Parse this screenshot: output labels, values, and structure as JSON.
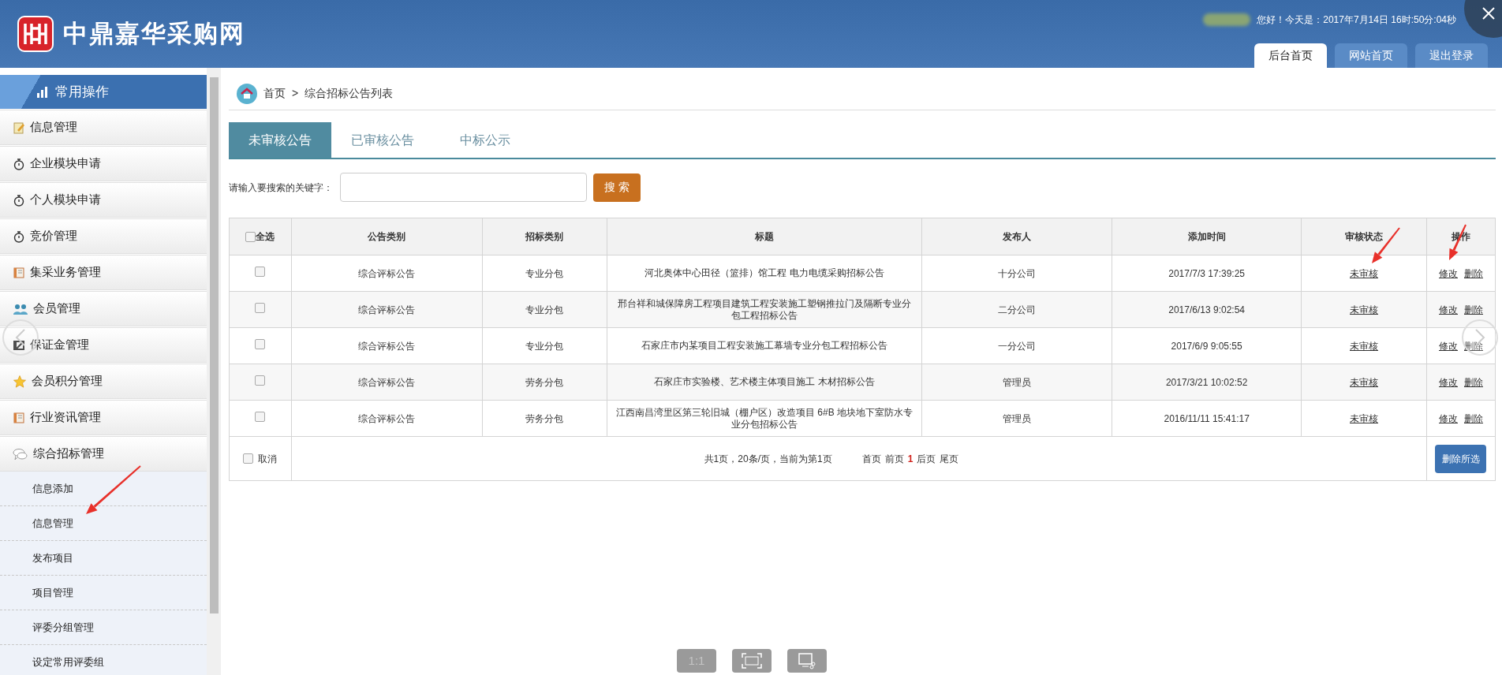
{
  "header": {
    "logo_text": "中鼎嘉华采购网",
    "greeting": "您好！今天是：2017年7月14日 16时:50分:04秒",
    "nav": [
      {
        "label": "后台首页",
        "selected": true
      },
      {
        "label": "网站首页",
        "selected": false
      },
      {
        "label": "退出登录",
        "selected": false
      }
    ]
  },
  "sidebar": {
    "title": "常用操作",
    "items": [
      {
        "label": "信息管理",
        "kind": "note"
      },
      {
        "label": "企业模块申请",
        "kind": "stopwatch"
      },
      {
        "label": "个人模块申请",
        "kind": "stopwatch"
      },
      {
        "label": "竞价管理",
        "kind": "stopwatch"
      },
      {
        "label": "集采业务管理",
        "kind": "book"
      },
      {
        "label": "会员管理",
        "kind": "people"
      },
      {
        "label": "保证金管理",
        "kind": "film"
      },
      {
        "label": "会员积分管理",
        "kind": "star"
      },
      {
        "label": "行业资讯管理",
        "kind": "book"
      },
      {
        "label": "综合招标管理",
        "kind": "chat",
        "children": [
          {
            "label": "信息添加"
          },
          {
            "label": "信息管理"
          },
          {
            "label": "发布项目"
          },
          {
            "label": "项目管理"
          },
          {
            "label": "评委分组管理"
          },
          {
            "label": "设定常用评委组"
          }
        ]
      }
    ]
  },
  "breadcrumb": {
    "home": "首页",
    "separator": ">",
    "current": "综合招标公告列表"
  },
  "tabs": [
    {
      "label": "未审核公告",
      "selected": true
    },
    {
      "label": "已审核公告",
      "selected": false
    },
    {
      "label": "中标公示",
      "selected": false
    }
  ],
  "search": {
    "label": "请输入要搜索的关键字：",
    "button": "搜 索"
  },
  "table": {
    "select_all": {
      "label": "全选",
      "checked": false
    },
    "columns": [
      "公告类别",
      "招标类别",
      "标题",
      "发布人",
      "添加时间",
      "审核状态",
      "操作"
    ],
    "rows": [
      {
        "checked": false,
        "category": "综合评标公告",
        "type": "专业分包",
        "title": "河北奥体中心田径（篮排）馆工程 电力电缆采购招标公告",
        "publisher": "十分公司",
        "time": "2017/7/3 17:39:25",
        "status": "未审核",
        "actions": [
          "修改",
          "删除"
        ]
      },
      {
        "checked": false,
        "category": "综合评标公告",
        "type": "专业分包",
        "title": "邢台祥和城保障房工程项目建筑工程安装施工塑钢推拉门及隔断专业分包工程招标公告",
        "publisher": "二分公司",
        "time": "2017/6/13 9:02:54",
        "status": "未审核",
        "actions": [
          "修改",
          "删除"
        ]
      },
      {
        "checked": false,
        "category": "综合评标公告",
        "type": "专业分包",
        "title": "石家庄市内某项目工程安装施工幕墙专业分包工程招标公告",
        "publisher": "一分公司",
        "time": "2017/6/9 9:05:55",
        "status": "未审核",
        "actions": [
          "修改",
          "删除"
        ]
      },
      {
        "checked": false,
        "category": "综合评标公告",
        "type": "劳务分包",
        "title": "石家庄市实验楼、艺术楼主体项目施工 木材招标公告",
        "publisher": "管理员",
        "time": "2017/3/21 10:02:52",
        "status": "未审核",
        "actions": [
          "修改",
          "删除"
        ]
      },
      {
        "checked": false,
        "category": "综合评标公告",
        "type": "劳务分包",
        "title": "江西南昌湾里区第三轮旧城（棚户区）改造项目 6#B 地块地下室防水专业分包招标公告",
        "publisher": "管理员",
        "time": "2016/11/11 15:41:17",
        "status": "未审核",
        "actions": [
          "修改",
          "删除"
        ]
      }
    ],
    "footer": {
      "cancel": {
        "label": "取消",
        "checked": false
      },
      "summary": "共1页，20条/页，当前为第1页",
      "pager": [
        {
          "label": "首页",
          "selected": false
        },
        {
          "label": "前页",
          "selected": false
        },
        {
          "label": "1",
          "selected": true
        },
        {
          "label": "后页",
          "selected": false
        },
        {
          "label": "尾页",
          "selected": false
        }
      ],
      "delete_button": "删除所选"
    }
  },
  "viewer": {
    "zoom_label": "1:1"
  }
}
